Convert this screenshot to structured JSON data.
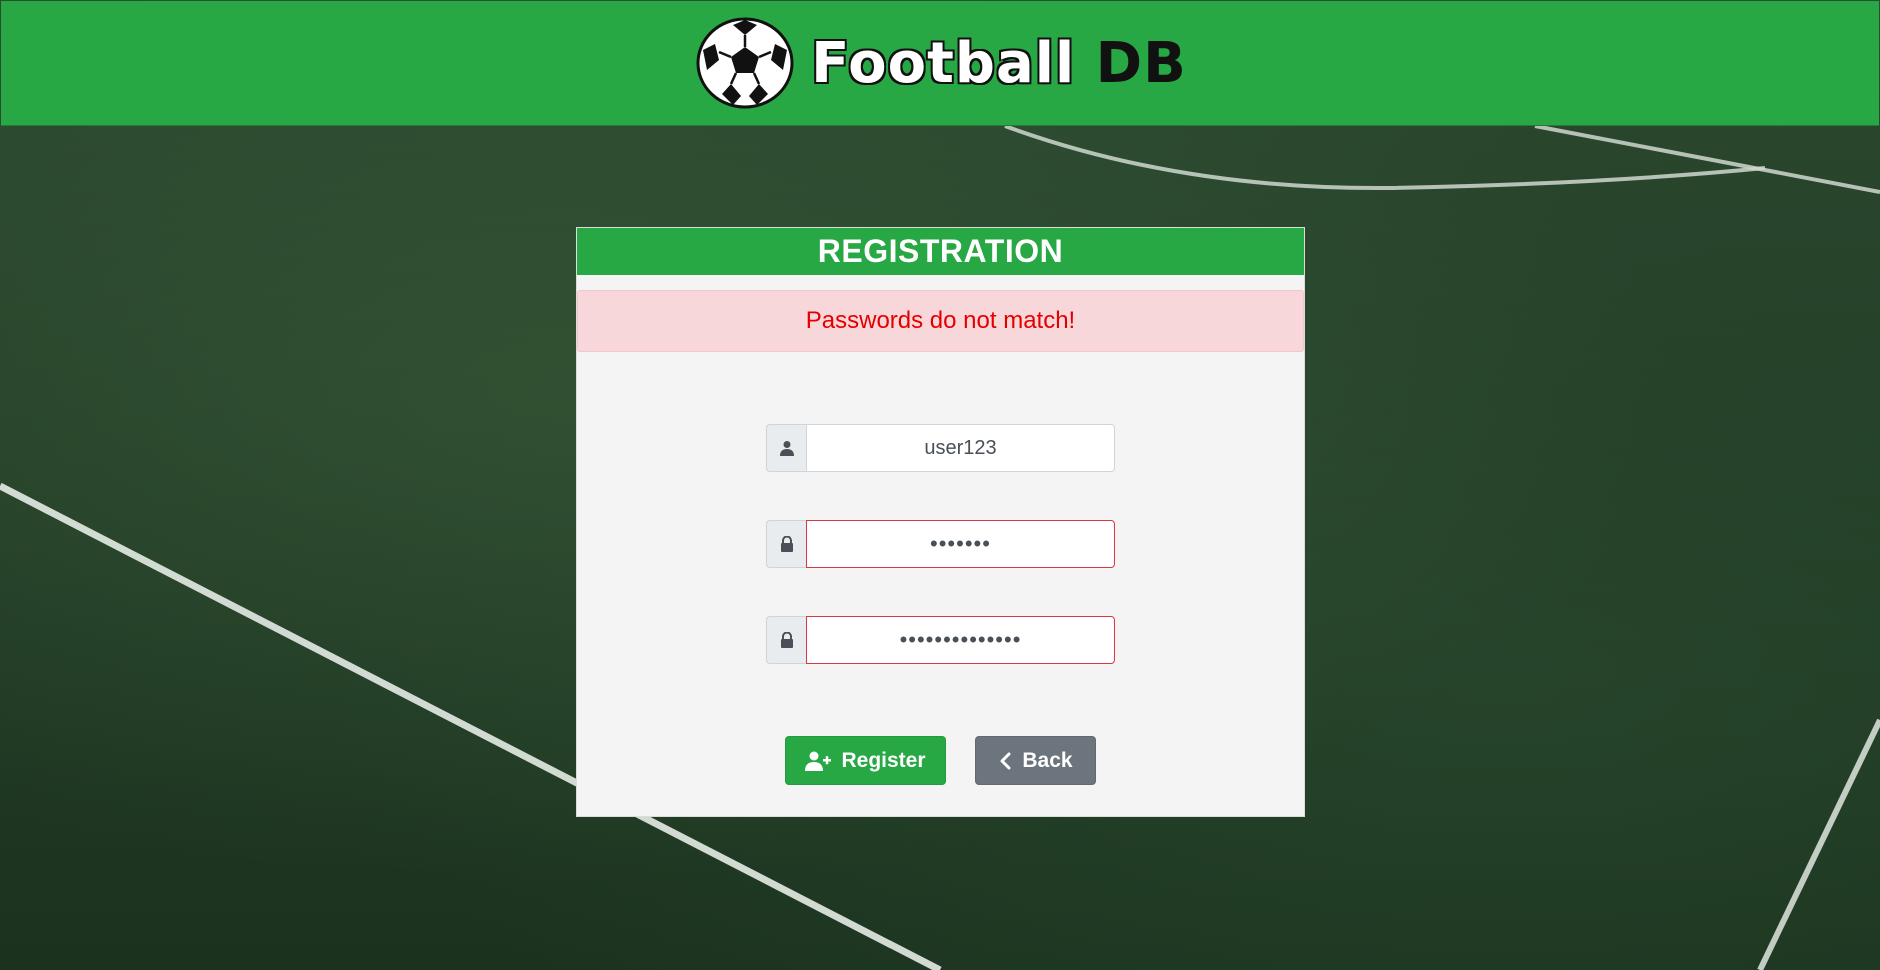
{
  "header": {
    "brand_main": "Football",
    "brand_accent": "DB",
    "logo_icon": "soccer-ball-icon"
  },
  "card": {
    "title": "REGISTRATION",
    "alert": "Passwords do not match!"
  },
  "form": {
    "username": {
      "value": "user123",
      "icon": "user-icon"
    },
    "password": {
      "value": "•••••••",
      "icon": "lock-icon"
    },
    "confirm_password": {
      "value": "••••••••••••••",
      "icon": "lock-icon"
    }
  },
  "buttons": {
    "register_label": "Register",
    "back_label": "Back"
  },
  "colors": {
    "brand_green": "#28a745",
    "alert_bg": "#f8d7da",
    "alert_text": "#e50000",
    "error_border": "#dc3545",
    "back_gray": "#6c757d"
  }
}
